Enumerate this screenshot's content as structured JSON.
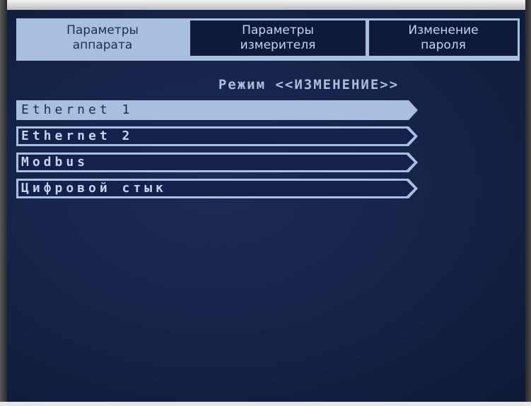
{
  "tabs": [
    {
      "label": "Параметры\nаппарата",
      "active": true
    },
    {
      "label": "Параметры\nизмерителя",
      "active": false
    },
    {
      "label": "Изменение\nпароля",
      "active": false
    }
  ],
  "mode_title": "Режим <<ИЗМЕНЕНИЕ>>",
  "menu": {
    "items": [
      {
        "label": "Ethernet 1",
        "selected": true
      },
      {
        "label": "Ethernet 2",
        "selected": false
      },
      {
        "label": "Modbus",
        "selected": false
      },
      {
        "label": "Цифровой стык",
        "selected": false
      }
    ]
  },
  "colors": {
    "screen_background": "#16244a",
    "accent": "#a9bfe0",
    "active_text": "#1c2d55",
    "inactive_text": "#c4d4ee"
  }
}
